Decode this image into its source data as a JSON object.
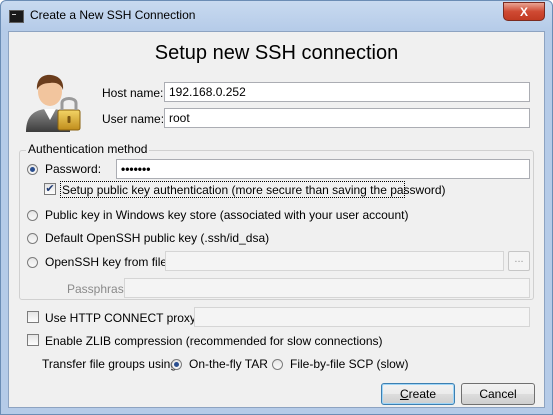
{
  "window": {
    "title": "Create a New SSH Connection",
    "close_label": "X"
  },
  "dialog": {
    "heading": "Setup new SSH connection",
    "host": {
      "label": "Host name:",
      "value": "192.168.0.252"
    },
    "user": {
      "label": "User name:",
      "value": "root"
    }
  },
  "auth": {
    "legend": "Authentication method",
    "password": {
      "label": "Password:",
      "value": "•••••••",
      "selected": true
    },
    "setup_pubkey": {
      "label": "Setup public key authentication (more secure than saving the password)",
      "checked": true
    },
    "windows_keystore": {
      "label": "Public key in Windows key store (associated with your user account)"
    },
    "default_openssh": {
      "label": "Default OpenSSH public key (.ssh/id_dsa)"
    },
    "openssh_file": {
      "label": "OpenSSH key from file:",
      "value": "",
      "browse_label": "..."
    },
    "passphrase": {
      "label": "Passphrase:",
      "value": ""
    }
  },
  "options": {
    "http_proxy": {
      "label": "Use HTTP CONNECT proxy:",
      "value": "",
      "checked": false
    },
    "zlib": {
      "label": "Enable ZLIB compression (recommended for slow connections)",
      "checked": false
    },
    "transfer": {
      "label": "Transfer file groups using:",
      "options": [
        {
          "label": "On-the-fly TAR",
          "selected": true
        },
        {
          "label": "File-by-file SCP (slow)",
          "selected": false
        }
      ]
    }
  },
  "buttons": {
    "create_prefix": "",
    "create_mnemonic": "C",
    "create_rest": "reate",
    "cancel_label": "Cancel"
  },
  "icons": {
    "title": "terminal-icon",
    "avatar": "user-lock-icon"
  },
  "colors": {
    "titlebar": "#b5cbe8",
    "close_button": "#c13a22",
    "default_button_border": "#3c7fb1"
  }
}
